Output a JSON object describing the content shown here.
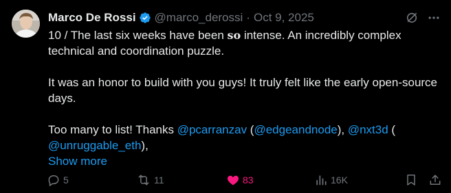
{
  "author": {
    "display_name": "Marco De Rossi",
    "handle": "@marco_derossi",
    "separator": "·",
    "date": "Oct 9, 2025"
  },
  "body": {
    "p1_prefix": "10 / The last six weeks have been ",
    "p1_bold": "so",
    "p1_suffix": " intense. An incredibly complex technical and coordination puzzle.",
    "p2": "It was an honor to build with you guys! It truly felt like the early open-source days.",
    "p3_prefix": "Too many to list! Thanks ",
    "m1": "@pcarranzav",
    "p3_a": " (",
    "m2": "@edgeandnode",
    "p3_b": "), ",
    "m3": "@nxt3d",
    "p3_c": " (",
    "m4": "@unruggable_eth",
    "p3_d": "),",
    "show_more": "Show more"
  },
  "actions": {
    "replies": "5",
    "reposts": "11",
    "likes": "83",
    "views": "16K"
  },
  "colors": {
    "background": "#000000",
    "text": "#e7e9ea",
    "muted": "#71767b",
    "link": "#1d9bf0",
    "like": "#f91880",
    "verified": "#1d9bf0"
  }
}
